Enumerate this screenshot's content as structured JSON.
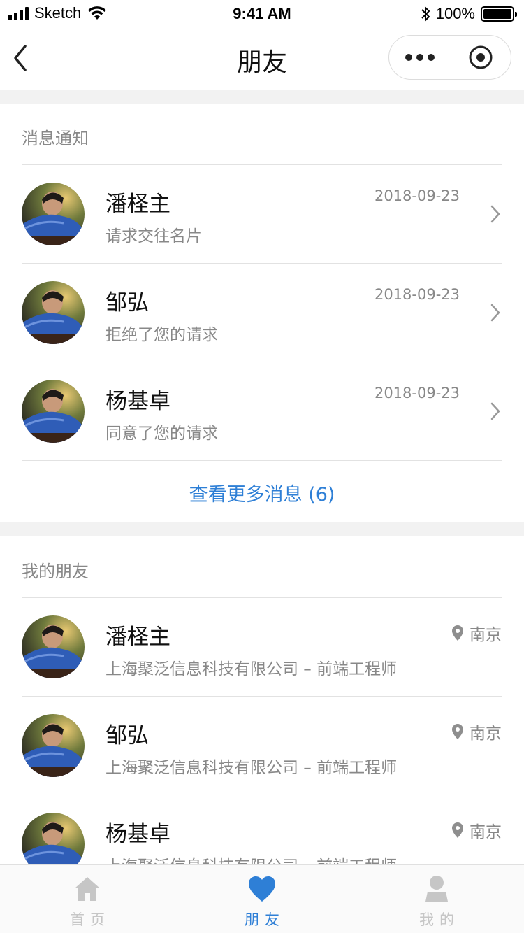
{
  "status_bar": {
    "carrier": "Sketch",
    "time": "9:41 AM",
    "battery_pct": "100%"
  },
  "nav": {
    "title": "朋友"
  },
  "notifications": {
    "section_title": "消息通知",
    "items": [
      {
        "name": "潘柽主",
        "message": "请求交往名片",
        "date": "2018-09-23"
      },
      {
        "name": "邹弘",
        "message": "拒绝了您的请求",
        "date": "2018-09-23"
      },
      {
        "name": "杨基卓",
        "message": "同意了您的请求",
        "date": "2018-09-23"
      }
    ],
    "more_link": "查看更多消息 (6)"
  },
  "friends": {
    "section_title": "我的朋友",
    "items": [
      {
        "name": "潘柽主",
        "company": "上海聚泛信息科技有限公司 – 前端工程师",
        "city": "南京"
      },
      {
        "name": "邹弘",
        "company": "上海聚泛信息科技有限公司 – 前端工程师",
        "city": "南京"
      },
      {
        "name": "杨基卓",
        "company": "上海聚泛信息科技有限公司 – 前端工程师",
        "city": "南京"
      }
    ]
  },
  "tabs": [
    {
      "label": "首页",
      "icon": "home-icon",
      "active": false
    },
    {
      "label": "朋友",
      "icon": "heart-icon",
      "active": true
    },
    {
      "label": "我的",
      "icon": "person-icon",
      "active": false
    }
  ],
  "colors": {
    "accent": "#2e7fd6",
    "text_primary": "#111111",
    "text_secondary": "#888888",
    "background": "#f2f2f2"
  }
}
